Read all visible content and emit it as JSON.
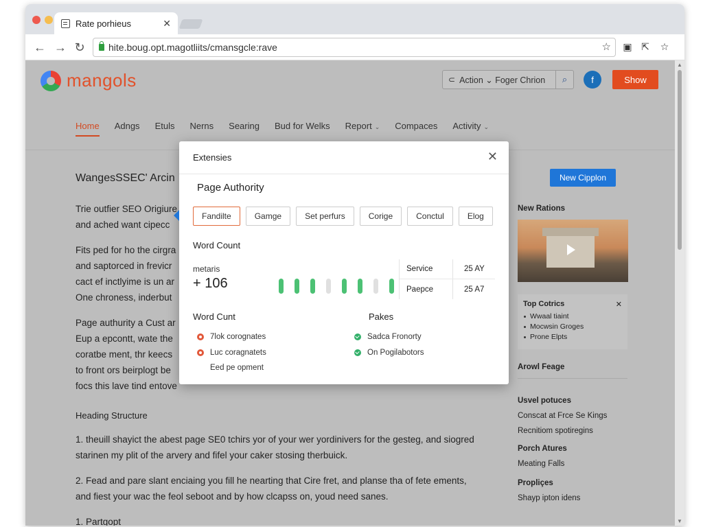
{
  "browser": {
    "tab_title": "Rate porhieus",
    "url": "hite.boug.opt.magotliits/cmansgcle:rave"
  },
  "site": {
    "logo_text": "mangols",
    "search_text": "Action ⌄ Foger Chrion",
    "avatar_letter": "f",
    "show_button": "Show"
  },
  "nav": {
    "items": [
      {
        "label": "Home",
        "active": true
      },
      {
        "label": "Adngs"
      },
      {
        "label": "Etuls"
      },
      {
        "label": "Nerns"
      },
      {
        "label": "Searing"
      },
      {
        "label": "Bud for Welks"
      },
      {
        "label": "Report",
        "dropdown": true
      },
      {
        "label": "Compaces"
      },
      {
        "label": "Activity",
        "dropdown": true
      }
    ]
  },
  "article": {
    "title": "WangesSSEC' Arcin",
    "paragraphs": [
      [
        "Trie outfier SEO Origiure",
        "and ached want cipecc"
      ],
      [
        "Fits ped for ho the cirgra",
        "and saptorced in frevicr",
        "cact ef inctlyime is un ar",
        "One chroness, inderbut"
      ],
      [
        "Page authurity a Cust ar",
        "Eup a epcontt, wate the",
        "coratbe ment, thr keecs",
        "to front ors beirplogt be",
        "focs this lave tind entove"
      ]
    ],
    "heading": "Heading Structure",
    "items": [
      [
        "1. theuill shayict the abest page SE0 tchirs yor of your wer yordinivers for the gesteg, and siogred",
        "starinen my plit of the arvery and fifel your caker stosing therbuick."
      ],
      [
        "2. Fead and pare slant enciaing you fill he nearting that Cire fret, and planse tha of fete ements,",
        "and fiest your wac the feol seboot and by how clcapss on, youd need sanes."
      ],
      [
        "1. Partgopt"
      ]
    ]
  },
  "sidebar": {
    "new_button": "New Cipplon",
    "new_rations": "New Rations",
    "top_box": {
      "title": "Top Cotrics",
      "items": [
        "Wwaal tiaint",
        "Mocwsin Groges",
        "Prone Elpts"
      ]
    },
    "around_page": "Arowl Feage",
    "useful_title": "Usvel potuces",
    "links1": [
      "Conscat at Frce Se Kings",
      "Recnitiom spotiregins"
    ],
    "porch_title": "Porch Atures",
    "porch_link": "Meating Falls",
    "propl_title": "Propliçes",
    "propl_link": "Shayp ipton idens"
  },
  "dialog": {
    "title": "Extensies",
    "subtitle": "Page Authority",
    "chips": [
      "Fandilte",
      "Gamge",
      "Set perfurs",
      "Corige",
      "Conctul",
      "Elog"
    ],
    "word_count_label": "Word Count",
    "metric_label": "metaris",
    "metric_value": "+ 106",
    "bar_colors": [
      "#4cc174",
      "#4cc174",
      "#4cc174",
      "#e0e0e0",
      "#4cc174",
      "#4cc174",
      "#e0e0e0",
      "#4cc174"
    ],
    "stats": [
      {
        "label": "Service",
        "value": "25 AY"
      },
      {
        "label": "Paepce",
        "value": "25 A7"
      }
    ],
    "left_col_title": "Word Cunt",
    "left_items": [
      {
        "label": "7lok corognates",
        "status": "red"
      },
      {
        "label": "Luc coragnatets",
        "status": "red"
      },
      {
        "label": "Eed pe opment",
        "status": "none"
      }
    ],
    "right_col_title": "Pakes",
    "right_items": [
      {
        "label": "Sadca Fronorty",
        "status": "green"
      },
      {
        "label": "On Pogilabotors",
        "status": "green"
      }
    ]
  }
}
